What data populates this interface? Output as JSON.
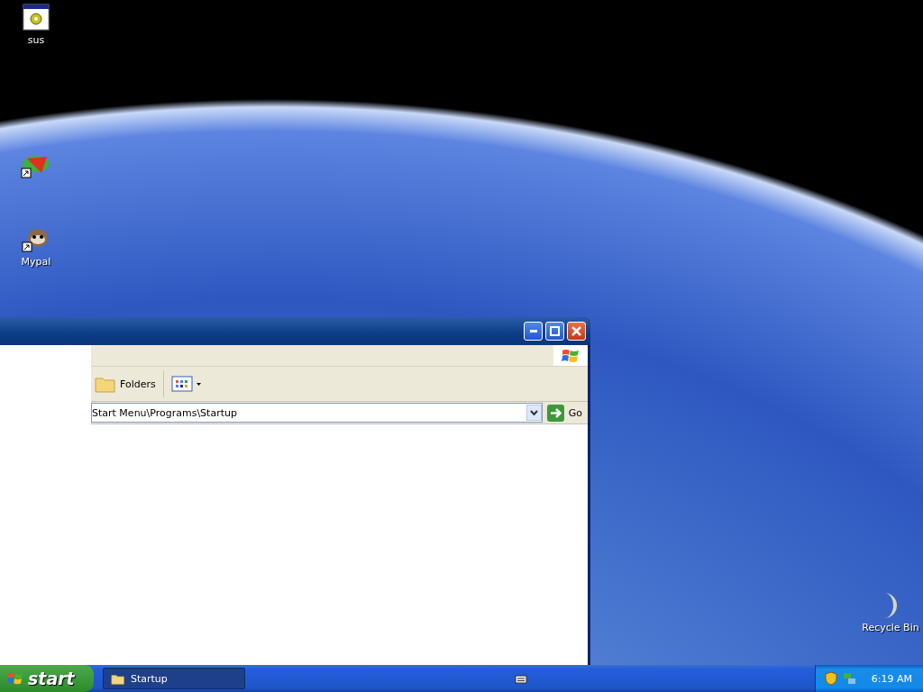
{
  "desktop": {
    "icons": [
      {
        "kind": "program",
        "label": "sus"
      },
      {
        "kind": "shortcut"
      },
      {
        "kind": "mypal",
        "label": "Mypal"
      },
      {
        "kind": "recycle",
        "label": "Recycle Bin"
      }
    ]
  },
  "window": {
    "toolbar": {
      "folders": "Folders"
    },
    "address": {
      "value": "Start Menu\\Programs\\Startup",
      "go": "Go"
    }
  },
  "taskbar": {
    "start": "start",
    "tasks": [
      {
        "label": "Startup",
        "selected": true
      }
    ],
    "clock": "6:19 AM"
  }
}
